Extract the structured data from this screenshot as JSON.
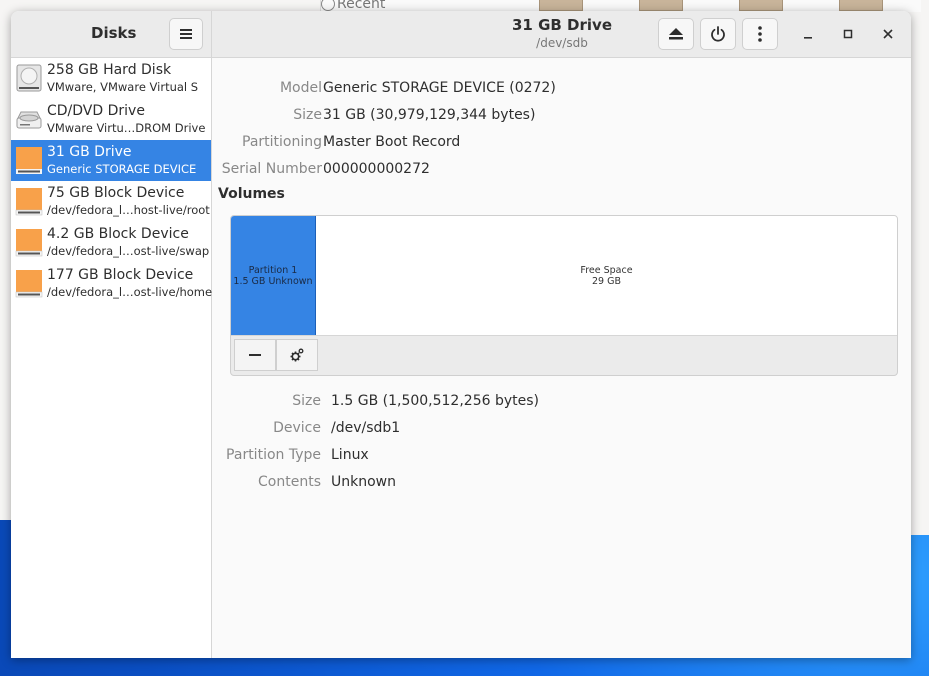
{
  "background": {
    "recent_label": "Recent"
  },
  "sidebar": {
    "title": "Disks",
    "drives": [
      {
        "name": "258 GB Hard Disk",
        "sub": "VMware, VMware Virtual S",
        "icon": "hard-disk-icon"
      },
      {
        "name": "CD/DVD Drive",
        "sub": "VMware Virtu…DROM Drive",
        "icon": "optical-drive-icon"
      },
      {
        "name": "31 GB Drive",
        "sub": "Generic STORAGE DEVICE",
        "icon": "usb-drive-icon",
        "selected": true
      },
      {
        "name": "75 GB Block Device",
        "sub": "/dev/fedora_l…host-live/root",
        "icon": "block-device-icon"
      },
      {
        "name": "4.2 GB Block Device",
        "sub": "/dev/fedora_l…ost-live/swap",
        "icon": "block-device-icon"
      },
      {
        "name": "177 GB Block Device",
        "sub": "/dev/fedora_l…ost-live/home",
        "icon": "block-device-icon"
      }
    ]
  },
  "header": {
    "title": "31 GB Drive",
    "subtitle": "/dev/sdb"
  },
  "drive_info": {
    "model_label": "Model",
    "model_value": "Generic STORAGE DEVICE (0272)",
    "size_label": "Size",
    "size_value": "31 GB (30,979,129,344 bytes)",
    "partitioning_label": "Partitioning",
    "partitioning_value": "Master Boot Record",
    "serial_label": "Serial Number",
    "serial_value": "000000000272"
  },
  "volumes": {
    "heading": "Volumes",
    "partition": {
      "name": "Partition 1",
      "detail": "1.5 GB Unknown"
    },
    "free_space": {
      "name": "Free Space",
      "detail": "29 GB"
    }
  },
  "volume_info": {
    "size_label": "Size",
    "size_value": "1.5 GB (1,500,512,256 bytes)",
    "device_label": "Device",
    "device_value": "/dev/sdb1",
    "type_label": "Partition Type",
    "type_value": "Linux",
    "contents_label": "Contents",
    "contents_value": "Unknown"
  },
  "colors": {
    "accent": "#3584e4",
    "drive_orange": "#f8a14a"
  }
}
